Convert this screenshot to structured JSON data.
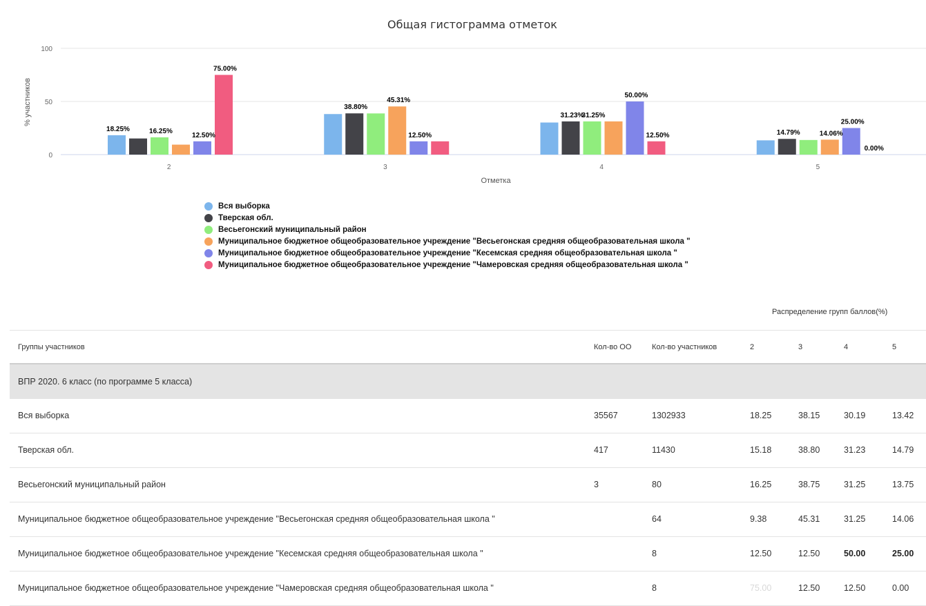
{
  "chart_data": {
    "type": "bar",
    "title": "Общая гистограмма отметок",
    "xlabel": "Отметка",
    "ylabel": "% участников",
    "ylim": [
      0,
      100
    ],
    "yticks": [
      0,
      50,
      100
    ],
    "grid": true,
    "legend_position": "bottom-left",
    "categories": [
      "2",
      "3",
      "4",
      "5"
    ],
    "series": [
      {
        "name": "Вся выборка",
        "color": "#7cb5ec",
        "values": [
          18.25,
          38.15,
          30.19,
          13.42
        ],
        "labels": [
          "18.25%",
          "",
          "",
          ""
        ]
      },
      {
        "name": "Тверская обл.",
        "color": "#434348",
        "values": [
          15.18,
          38.8,
          31.23,
          14.79
        ],
        "labels": [
          "",
          "38.80%",
          "31.23%",
          "14.79%"
        ]
      },
      {
        "name": "Весьегонский муниципальный район",
        "color": "#90ed7d",
        "values": [
          16.25,
          38.75,
          31.25,
          13.75
        ],
        "labels": [
          "16.25%",
          "",
          "31.25%",
          ""
        ]
      },
      {
        "name": "Муниципальное бюджетное общеобразовательное учреждение \"Весьегонская средняя общеобразовательная школа \"",
        "color": "#f7a35c",
        "values": [
          9.38,
          45.31,
          31.25,
          14.06
        ],
        "labels": [
          "",
          "45.31%",
          "",
          "14.06%"
        ]
      },
      {
        "name": "Муниципальное бюджетное общеобразовательное учреждение \"Кесемская средняя общеобразовательная школа \"",
        "color": "#8085e9",
        "values": [
          12.5,
          12.5,
          50.0,
          25.0
        ],
        "labels": [
          "12.50%",
          "12.50%",
          "50.00%",
          "25.00%"
        ]
      },
      {
        "name": "Муниципальное бюджетное общеобразовательное учреждение \"Чамеровская средняя общеобразовательная школа \"",
        "color": "#f15c80",
        "values": [
          75.0,
          12.5,
          12.5,
          0.0
        ],
        "labels": [
          "75.00%",
          "",
          "12.50%",
          "0.00%"
        ]
      }
    ]
  },
  "table": {
    "caption": "Распределение групп баллов(%)",
    "headers": {
      "group": "Группы участников",
      "oo": "Кол-во ОО",
      "participants": "Кол-во участников",
      "g2": "2",
      "g3": "3",
      "g4": "4",
      "g5": "5"
    },
    "section": "ВПР 2020. 6 класс (по программе 5 класса)",
    "rows": [
      {
        "name": "Вся выборка",
        "oo": "35567",
        "participants": "1302933",
        "g2": "18.25",
        "g3": "38.15",
        "g4": "30.19",
        "g5": "13.42"
      },
      {
        "name": "Тверская обл.",
        "oo": "417",
        "participants": "11430",
        "g2": "15.18",
        "g3": "38.80",
        "g4": "31.23",
        "g5": "14.79"
      },
      {
        "name": "Весьегонский муниципальный район",
        "oo": "3",
        "participants": "80",
        "g2": "16.25",
        "g3": "38.75",
        "g4": "31.25",
        "g5": "13.75"
      },
      {
        "name": "Муниципальное бюджетное общеобразовательное учреждение \"Весьегонская средняя общеобразовательная школа \"",
        "oo": "",
        "participants": "64",
        "g2": "9.38",
        "g3": "45.31",
        "g4": "31.25",
        "g5": "14.06"
      },
      {
        "name": "Муниципальное бюджетное общеобразовательное учреждение \"Кесемская средняя общеобразовательная школа \"",
        "oo": "",
        "participants": "8",
        "g2": "12.50",
        "g3": "12.50",
        "g4": "50.00",
        "g5": "25.00"
      },
      {
        "name": "Муниципальное бюджетное общеобразовательное учреждение \"Чамеровская средняя общеобразовательная школа \"",
        "oo": "",
        "participants": "8",
        "g2": "75.00",
        "g3": "12.50",
        "g4": "12.50",
        "g5": "0.00"
      }
    ]
  }
}
